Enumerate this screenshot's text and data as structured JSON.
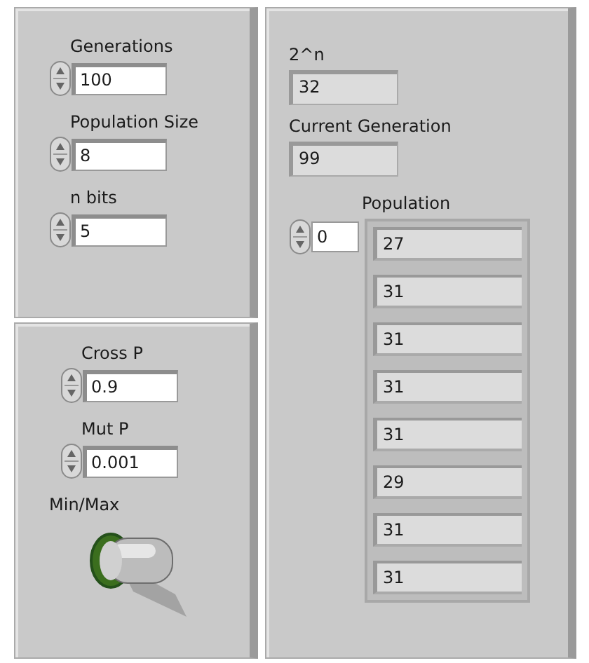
{
  "left_top": {
    "controls": [
      {
        "label": "Generations",
        "value": "100"
      },
      {
        "label": "Population Size",
        "value": "8"
      },
      {
        "label": "n bits",
        "value": "5"
      }
    ]
  },
  "left_bottom": {
    "controls": [
      {
        "label": "Cross P",
        "value": "0.9"
      },
      {
        "label": "Mut P",
        "value": "0.001"
      }
    ],
    "toggle": {
      "label": "Min/Max",
      "on": false
    }
  },
  "right": {
    "indicators": [
      {
        "label": "2^n",
        "value": "32"
      },
      {
        "label": "Current Generation",
        "value": "99"
      }
    ],
    "array": {
      "label": "Population",
      "index": "0",
      "elements": [
        "27",
        "31",
        "31",
        "31",
        "31",
        "29",
        "31",
        "31"
      ]
    }
  }
}
